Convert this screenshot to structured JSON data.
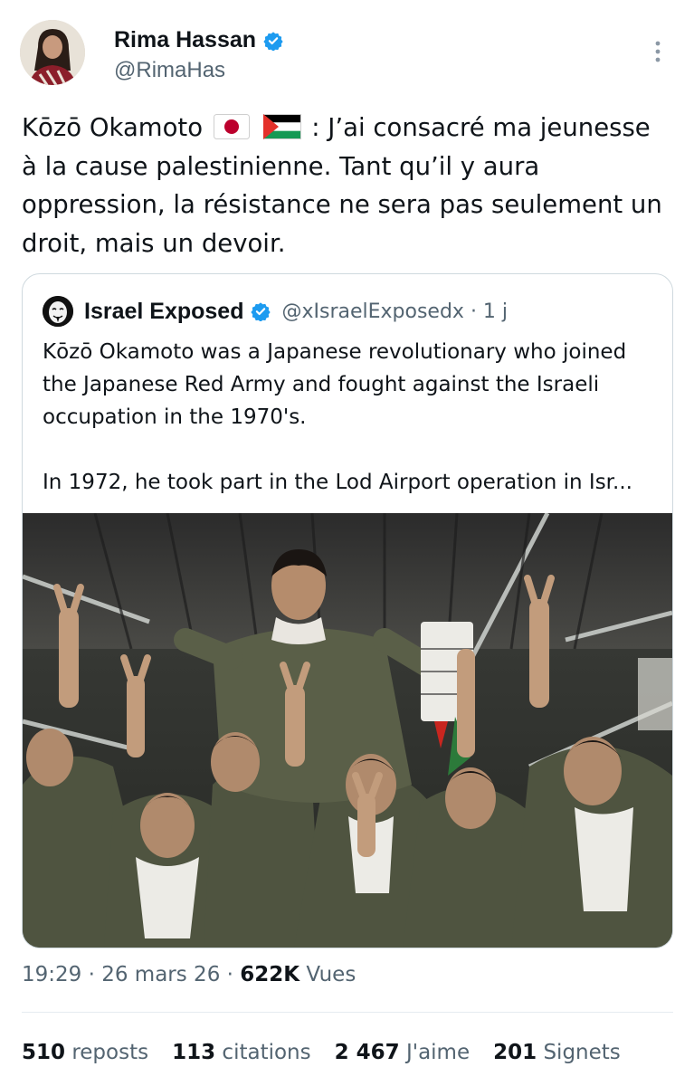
{
  "author": {
    "name": "Rima Hassan",
    "handle": "@RimaHas"
  },
  "tweet": {
    "text_before_flags": "Kōzō Okamoto",
    "flags": [
      "japan-flag-icon",
      "palestine-flag-icon"
    ],
    "text_after_flags": ": J’ai consacré ma jeunesse à la cause palestinienne. Tant qu’il y aura oppression, la résistance ne sera pas seulement un droit, mais un devoir."
  },
  "quoted": {
    "name": "Israel Exposed",
    "handle_time": "@xIsraelExposedx · 1 j",
    "paragraph1": "Kōzō Okamoto was a Japanese revolutionary who joined the Japanese Red Army and fought against the Israeli occupation in the 1970's.",
    "paragraph2": "In 1972, he took part in the Lod Airport operation in Isr..."
  },
  "meta": {
    "time": "19:29",
    "date": "26 mars 26",
    "views_count": "622K",
    "views_label": "Vues"
  },
  "stats": [
    {
      "count": "510",
      "label": "reposts"
    },
    {
      "count": "113",
      "label": "citations"
    },
    {
      "count": "2 467",
      "label": "J'aime"
    },
    {
      "count": "201",
      "label": "Signets"
    }
  ],
  "colors": {
    "text": "#0f1419",
    "muted": "#536471",
    "verified": "#1d9bf0",
    "border": "#cfd9de"
  }
}
